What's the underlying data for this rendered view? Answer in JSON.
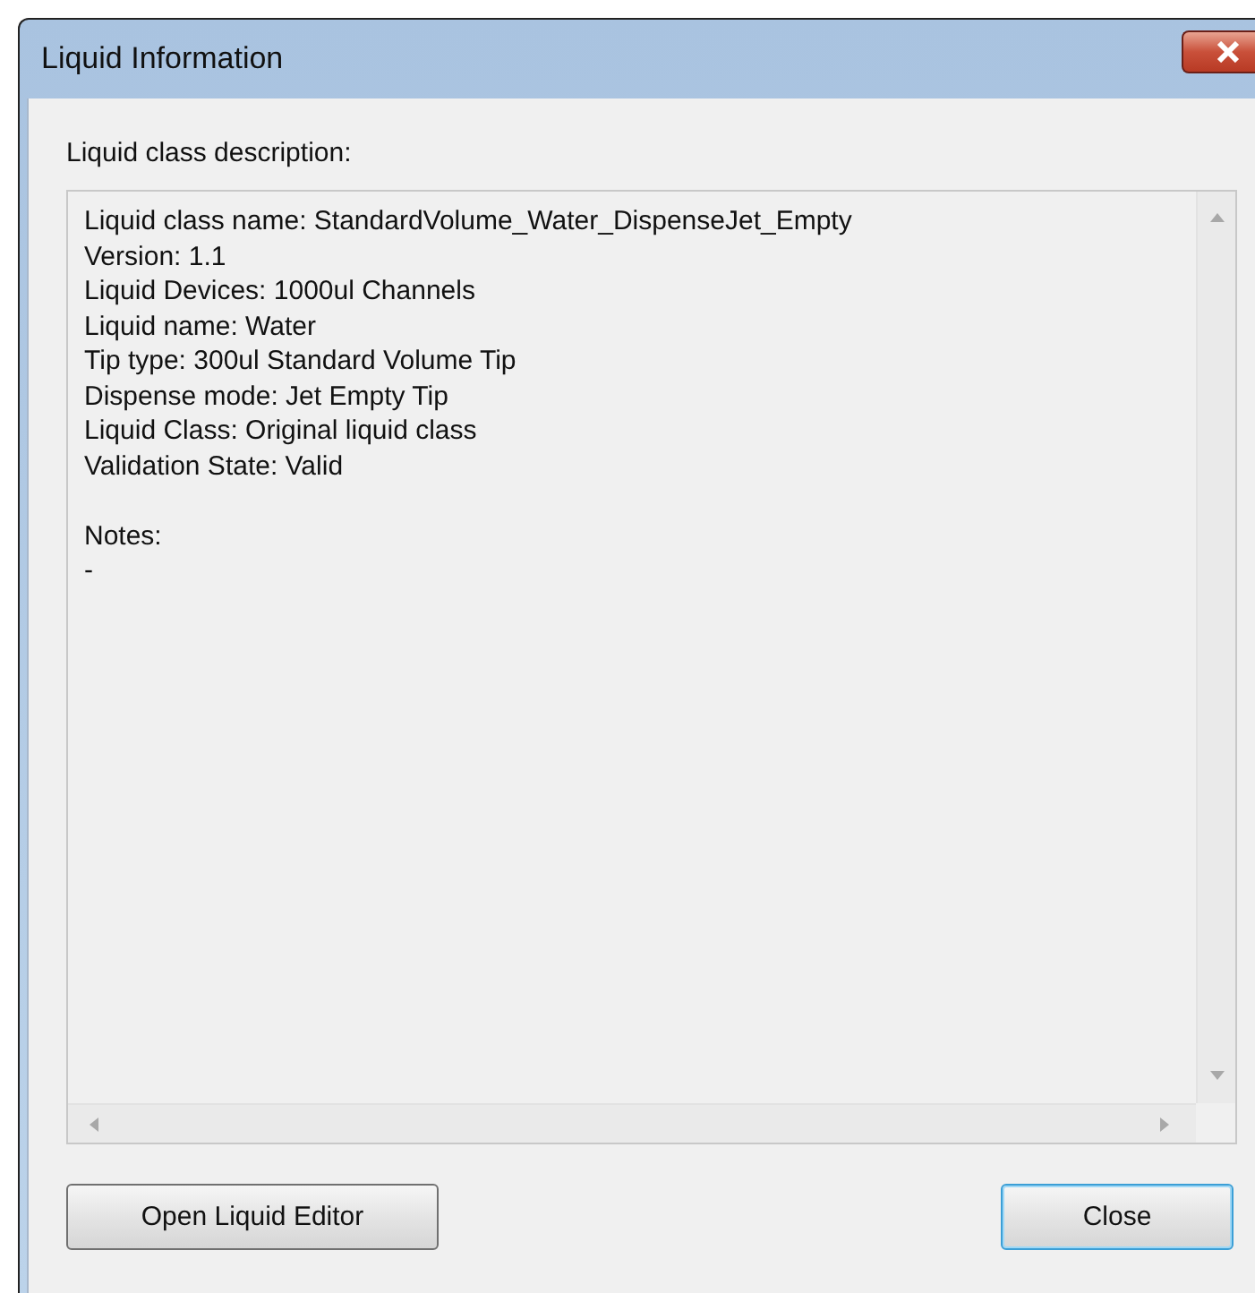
{
  "window": {
    "title": "Liquid Information"
  },
  "description_label": "Liquid class description:",
  "description": {
    "lines": [
      "Liquid class name: StandardVolume_Water_DispenseJet_Empty",
      "Version: 1.1",
      "Liquid Devices: 1000ul Channels",
      "Liquid name: Water",
      "Tip type: 300ul Standard Volume Tip",
      "Dispense mode: Jet Empty Tip",
      "Liquid Class: Original liquid class",
      "Validation State: Valid"
    ],
    "notes_heading": "Notes:",
    "notes": "-"
  },
  "buttons": [
    {
      "label": "Open Liquid Editor",
      "default": false
    },
    {
      "label": "Close",
      "default": true
    }
  ]
}
